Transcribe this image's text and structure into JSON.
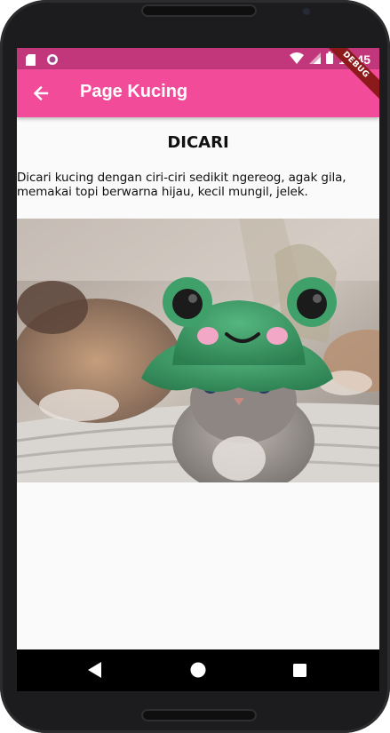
{
  "status_bar": {
    "time": "12:45",
    "icons": [
      "sd-card-icon",
      "app-notification-icon",
      "wifi-icon",
      "signal-icon",
      "battery-icon"
    ]
  },
  "app_bar": {
    "title": "Page Kucing",
    "back_icon": "arrow-left-icon",
    "debug_banner": "DEBUG"
  },
  "content": {
    "heading": "DICARI",
    "description": "Dicari kucing dengan ciri-ciri sedikit ngereog, agak gila, memakai topi berwarna hijau, kecil mungil, jelek.",
    "image": "kitten-wearing-green-frog-hat"
  },
  "nav_bar": {
    "buttons": [
      "back-triangle-icon",
      "home-circle-icon",
      "recents-square-icon"
    ]
  },
  "colors": {
    "status_bar": "#c2377b",
    "app_bar": "#f24b9a",
    "screen_background": "#fafafa",
    "hat": "#3fa06a"
  }
}
